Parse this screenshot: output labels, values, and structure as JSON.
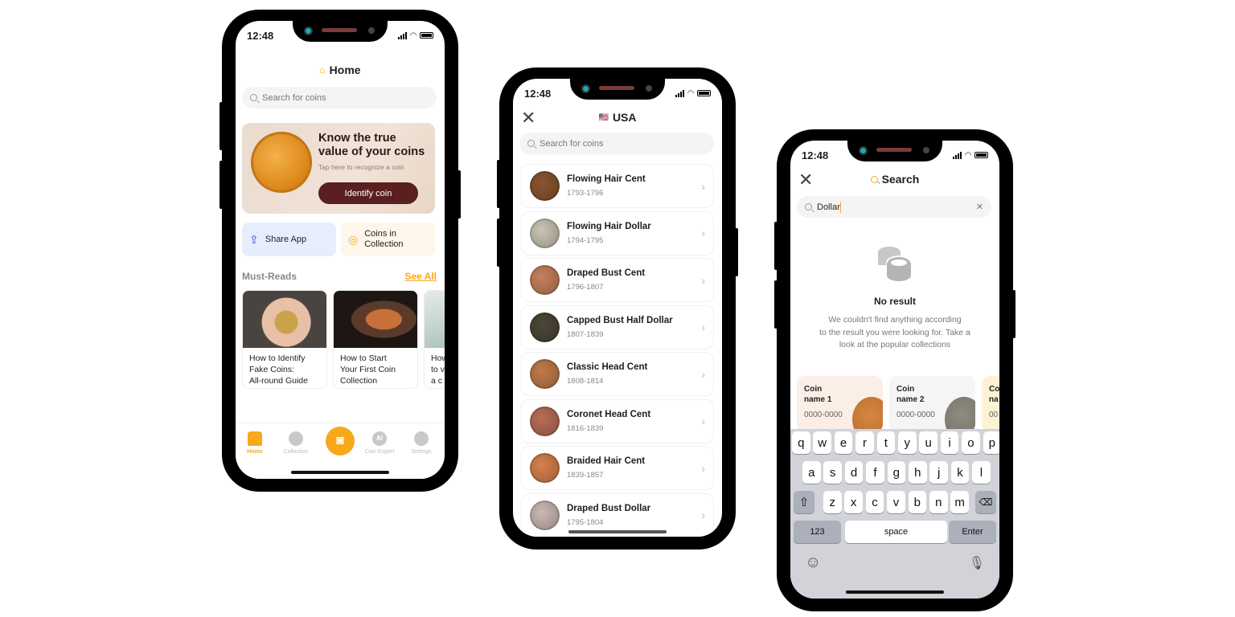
{
  "status_time": "12:48",
  "colors": {
    "accent": "#f7a81b",
    "brand_dark": "#5a1f1f"
  },
  "home": {
    "title": "Home",
    "title_icon": "home-icon",
    "search_placeholder": "Search for coins",
    "hero": {
      "heading_line1": "Know the true",
      "heading_line2": "value of your coins",
      "subtitle": "Tap here to recognize a coin",
      "button": "Identify coin"
    },
    "tiles": [
      {
        "label": "Share App",
        "icon": "share-icon"
      },
      {
        "label_line1": "Coins in",
        "label_line2": "Collection",
        "icon": "coins-icon"
      }
    ],
    "must_reads": {
      "title": "Must-Reads",
      "see_all": "See All",
      "articles": [
        {
          "line1": "How to Identify",
          "line2": "Fake Coins:",
          "line3": "All-round Guide"
        },
        {
          "line1": "How to Start",
          "line2": "Your First Coin",
          "line3": "Collection"
        },
        {
          "line1": "How",
          "line2": "to v",
          "line3": "a c"
        }
      ]
    },
    "tabs": [
      {
        "label": "Home",
        "icon": "home-icon",
        "active": true
      },
      {
        "label": "Collection",
        "icon": "collection-icon"
      },
      {
        "label": "",
        "icon": "camera-icon"
      },
      {
        "label": "Coin Expert",
        "icon": "ai-icon"
      },
      {
        "label": "Settings",
        "icon": "gear-icon"
      }
    ]
  },
  "usa": {
    "title": "USA",
    "flag": "🇺🇸",
    "search_placeholder": "Search for coins",
    "coins": [
      {
        "name": "Flowing Hair Cent",
        "years": "1793-1796",
        "color": "#8a5530"
      },
      {
        "name": "Flowing Hair Dollar",
        "years": "1794-1795",
        "color": "#c9c4b3"
      },
      {
        "name": "Draped Bust Cent",
        "years": "1796-1807",
        "color": "#c6805c"
      },
      {
        "name": "Capped Bust Half Dollar",
        "years": "1807-1839",
        "color": "#4d4738"
      },
      {
        "name": "Classic Head Cent",
        "years": "1808-1814",
        "color": "#c07b4b"
      },
      {
        "name": "Coronet Head Cent",
        "years": "1816-1839",
        "color": "#b86e56"
      },
      {
        "name": "Braided Hair Cent",
        "years": "1839-1857",
        "color": "#d6814c"
      },
      {
        "name": "Draped Bust Dollar",
        "years": "1795-1804",
        "color": "#cbb8b3"
      }
    ]
  },
  "search": {
    "title": "Search",
    "query": "Dollar",
    "empty_title": "No result",
    "empty_line1": "We couldn't find anything according",
    "empty_line2": "to the result you were looking for. Take a",
    "empty_line3": "look at the popular collections",
    "popular": [
      {
        "line1": "Coin",
        "line2": "name 1",
        "years": "0000-0000",
        "bg": "#fbeee6",
        "coin": "#d9863e"
      },
      {
        "line1": "Coin",
        "line2": "name 2",
        "years": "0000-0000",
        "bg": "#f5f5f5",
        "coin": "#8e8c80"
      },
      {
        "line1": "Co",
        "line2": "na",
        "years": "00",
        "bg": "#fdf1d6",
        "coin": "#e3b552"
      }
    ],
    "keyboard": {
      "row1": [
        "q",
        "w",
        "e",
        "r",
        "t",
        "y",
        "u",
        "i",
        "o",
        "p"
      ],
      "row2": [
        "a",
        "s",
        "d",
        "f",
        "g",
        "h",
        "j",
        "k",
        "l"
      ],
      "row3": [
        "z",
        "x",
        "c",
        "v",
        "b",
        "n",
        "m"
      ],
      "numbers": "123",
      "space": "space",
      "enter": "Enter"
    }
  }
}
